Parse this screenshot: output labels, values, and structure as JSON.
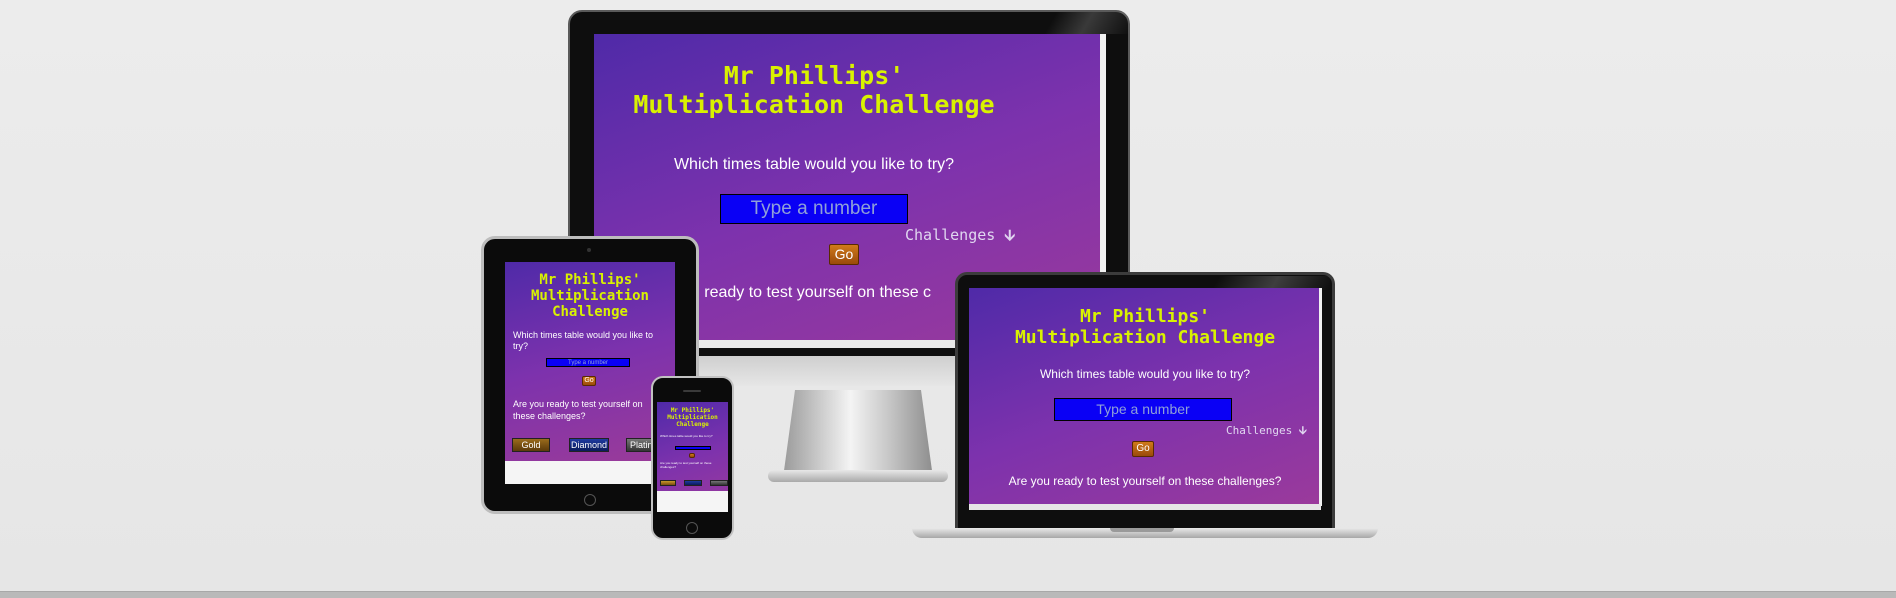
{
  "app": {
    "title_line1": "Mr Phillips'",
    "title_line2": "Multiplication Challenge",
    "title_line_multiplication": "Multiplication",
    "title_line_challenge": "Challenge",
    "question": "Which times table would you like to try?",
    "question_part1": "Which times table would you like to",
    "question_part2": "try?",
    "input_placeholder": "Type a number",
    "go_label": "Go",
    "challenges_label": "Challenges",
    "ready_text": "Are you ready to test yourself on these challenges?",
    "ready_part1": "Are you ready to test yourself on",
    "ready_part2": "these challenges?",
    "ready_cropped": "ou ready to test yourself on these c",
    "badges": [
      "Gold",
      "Diamond",
      "Platinum"
    ],
    "badges_cropped_last": "Platin"
  },
  "colors": {
    "title": "#d9f200",
    "input_bg": "#0a00f5",
    "go_bg": "#c0671a",
    "gradient_start": "#4f2aa8",
    "gradient_end": "#9b3a9b"
  }
}
